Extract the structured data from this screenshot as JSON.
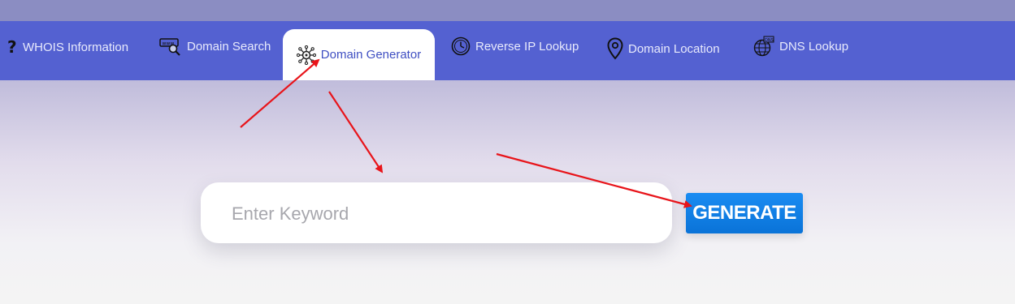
{
  "nav": {
    "items": [
      {
        "label": "WHOIS Information",
        "icon": "question-icon"
      },
      {
        "label": "Domain Search",
        "icon": "www-search-icon"
      },
      {
        "label": "Domain Generator",
        "icon": "network-gear-icon",
        "active": true
      },
      {
        "label": "Reverse IP Lookup",
        "icon": "clock-icon"
      },
      {
        "label": "Domain Location",
        "icon": "location-pin-icon"
      },
      {
        "label": "DNS Lookup",
        "icon": "dns-globe-icon"
      }
    ]
  },
  "search": {
    "placeholder": "Enter Keyword",
    "value": ""
  },
  "generate_button": {
    "label": "GENERATE"
  },
  "colors": {
    "nav_bg": "#5461d1",
    "active_tab_text": "#3f4fc2",
    "button_bg": "#0a7ee2",
    "annotation_arrow": "#e8141a"
  }
}
